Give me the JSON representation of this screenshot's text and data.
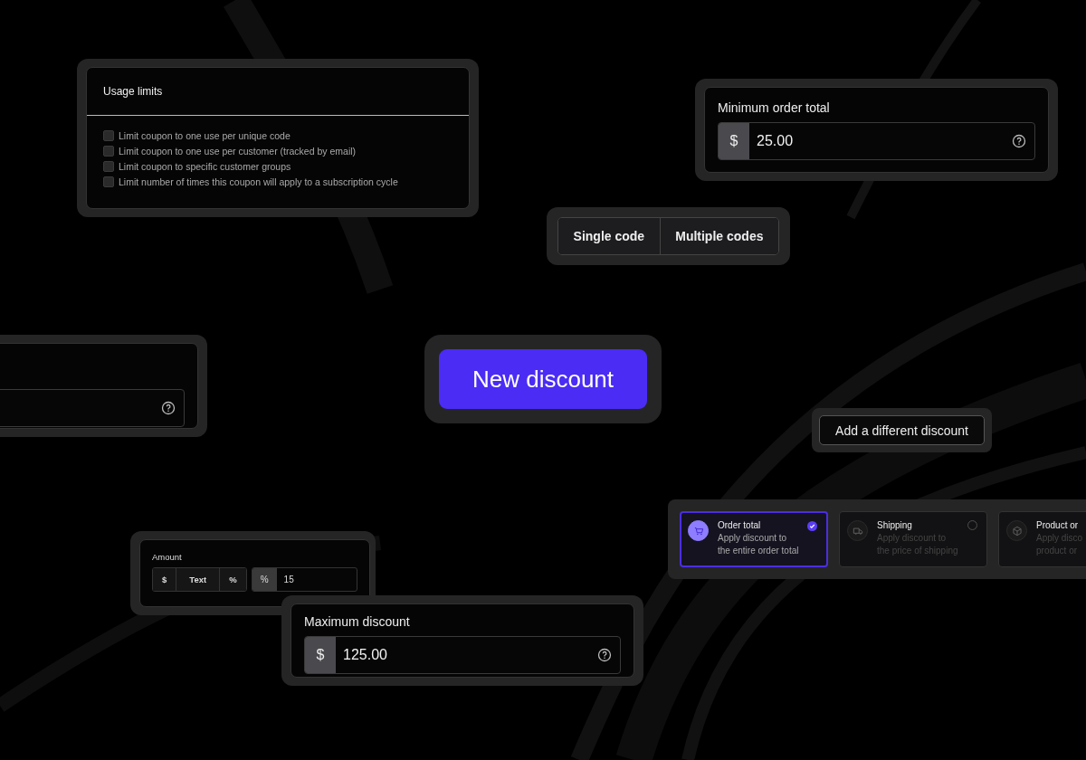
{
  "usage_limits": {
    "title": "Usage limits",
    "options": [
      {
        "label": "Limit coupon to one use per unique code",
        "checked": false
      },
      {
        "label": "Limit coupon to one use per customer (tracked by email)",
        "checked": false
      },
      {
        "label": "Limit coupon to specific customer groups",
        "checked": false
      },
      {
        "label": "Limit number of times this coupon will apply to a subscription cycle",
        "checked": false
      }
    ]
  },
  "minimum_order": {
    "label": "Minimum order total",
    "prefix": "$",
    "value": "25.00"
  },
  "code_mode": [
    {
      "label": "Single code",
      "selected": false
    },
    {
      "label": "Multiple codes",
      "selected": false
    }
  ],
  "new_discount_button": "New discount",
  "add_discount_button": "Add a different discount",
  "discount_types": [
    {
      "kind": "cart",
      "title": "Order total",
      "description": [
        "Apply discount to",
        "the entire order total"
      ],
      "selected": true
    },
    {
      "kind": "truck",
      "title": "Shipping",
      "description": [
        "Apply discount to",
        "the price of shipping"
      ],
      "selected": false
    },
    {
      "kind": "box",
      "title": "Product or",
      "description": [
        "Apply disco",
        "product or"
      ],
      "selected": false
    }
  ],
  "amount": {
    "label": "Amount",
    "units": [
      {
        "label": "$",
        "selected": false
      },
      {
        "label": "Text",
        "selected": false
      },
      {
        "label": "%",
        "selected": false
      }
    ],
    "prefix": "%",
    "value": "15"
  },
  "maximum_discount": {
    "label": "Maximum discount",
    "prefix": "$",
    "value": "125.00"
  }
}
